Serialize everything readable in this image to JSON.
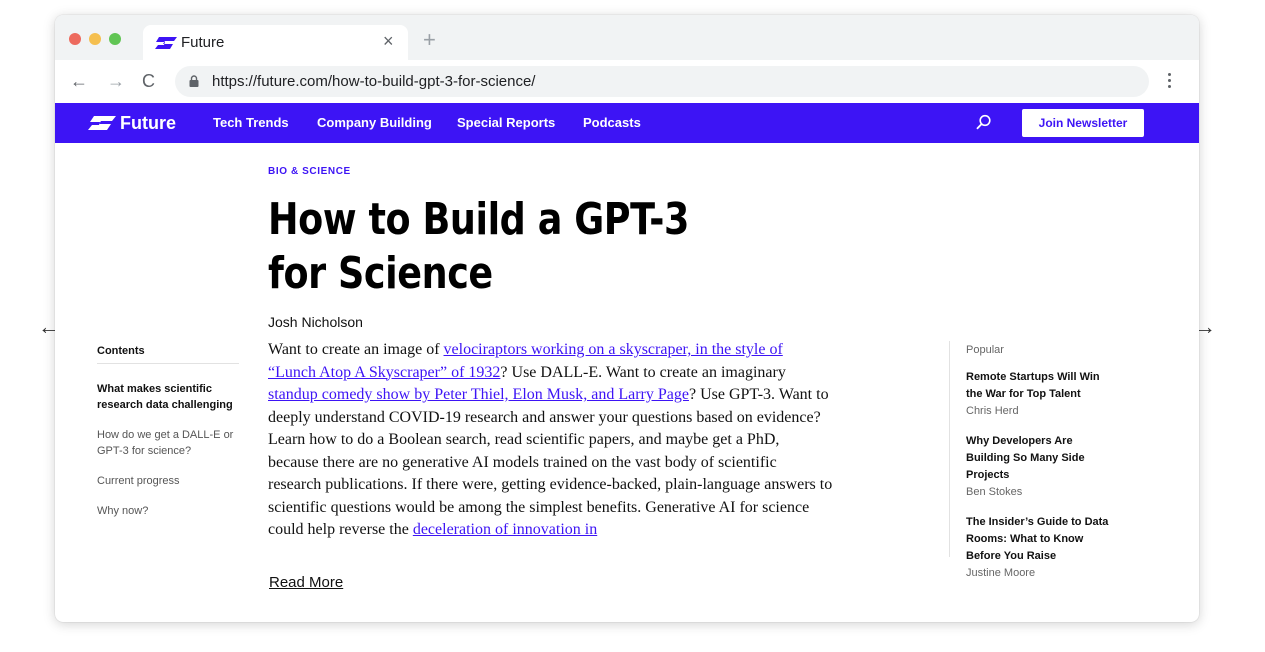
{
  "browser": {
    "tab_title": "Future",
    "close_glyph": "×",
    "new_tab_glyph": "+",
    "back_glyph": "←",
    "forward_glyph": "→",
    "reload_glyph": "C",
    "url": "https://future.com/how-to-build-gpt-3-for-science/"
  },
  "site": {
    "logo_text": "Future",
    "nav": [
      "Tech Trends",
      "Company Building",
      "Special Reports",
      "Podcasts"
    ],
    "newsletter_label": "Join Newsletter",
    "brand_color": "#3d14f5"
  },
  "article": {
    "kicker": "BIO & SCIENCE",
    "title": "How to Build a GPT-3 for Science",
    "author": "Josh Nicholson",
    "body": [
      {
        "t": "Want to create an image of "
      },
      {
        "t": "velociraptors working on a skyscraper, in the style of “Lunch Atop A Skyscraper” of 1932",
        "link": true
      },
      {
        "t": "? Use DALL-E. Want to create an imaginary "
      },
      {
        "t": "standup comedy show by Peter Thiel, Elon Musk, and Larry Page",
        "link": true
      },
      {
        "t": "? Use GPT-3. Want to deeply understand COVID-19 research and answer your questions based on evidence? Learn how to do a Boolean search, read scientific papers, and maybe get a PhD, because there are no generative AI models trained on the vast body of scientific research publications. If there were, getting evidence-backed, plain-language answers to scientific questions would be among the simplest benefits. Generative AI for science could help reverse the "
      },
      {
        "t": "deceleration of innovation in",
        "link": true
      }
    ],
    "read_more": "Read More"
  },
  "toc": {
    "heading": "Contents",
    "items": [
      "What makes scientific research data challenging",
      "How do we get a DALL-E or GPT-3 for science?",
      "Current progress",
      "Why now?"
    ]
  },
  "popular": {
    "heading": "Popular",
    "items": [
      {
        "title": "Remote Startups Will Win the War for Top Talent",
        "author": "Chris Herd"
      },
      {
        "title": "Why Developers Are Building So Many Side Projects",
        "author": "Ben Stokes"
      },
      {
        "title": "The Insider’s Guide to Data Rooms: What to Know Before You Raise",
        "author": "Justine Moore"
      }
    ]
  },
  "carousel": {
    "prev_glyph": "←",
    "next_glyph": "→"
  }
}
